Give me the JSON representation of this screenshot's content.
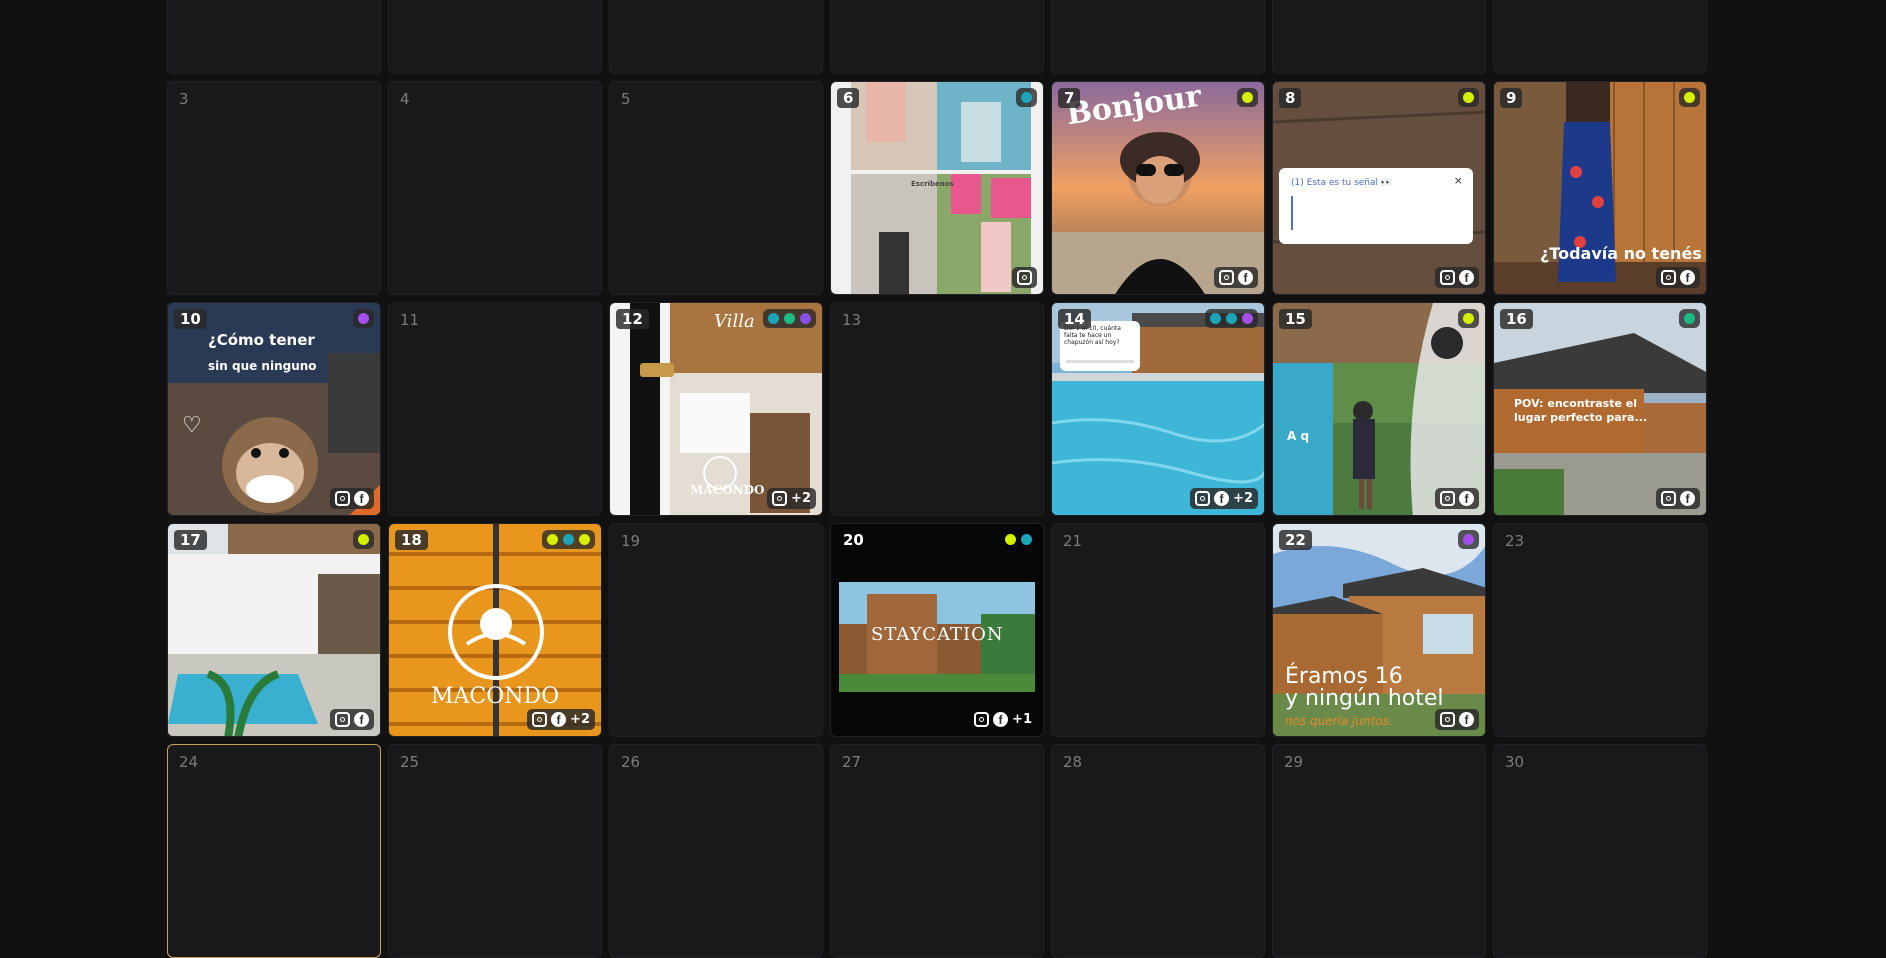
{
  "calendar": {
    "row0": [
      {},
      {},
      {},
      {},
      {},
      {},
      {}
    ],
    "rows": [
      [
        {
          "day": "3"
        },
        {
          "day": "4"
        },
        {
          "day": "5"
        },
        {
          "day": "6",
          "post": true,
          "dots": [
            "#1aa6b7"
          ],
          "platforms": [
            "instagram"
          ],
          "extra": "",
          "story_text": "Escríbenos"
        },
        {
          "day": "7",
          "post": true,
          "dots": [
            "#d4f000"
          ],
          "platforms": [
            "instagram",
            "facebook"
          ],
          "extra": "",
          "overlay": "Bonjour"
        },
        {
          "day": "8",
          "post": true,
          "dots": [
            "#d4f000"
          ],
          "platforms": [
            "instagram",
            "facebook"
          ],
          "extra": "",
          "overlay": "(1) Esta es tu señal 👀"
        },
        {
          "day": "9",
          "post": true,
          "dots": [
            "#d4f000"
          ],
          "platforms": [
            "instagram",
            "facebook"
          ],
          "extra": "",
          "overlay": "¿Todavía no tenés"
        }
      ],
      [
        {
          "day": "10",
          "post": true,
          "dots": [
            "#a64fe8"
          ],
          "platforms": [
            "instagram",
            "facebook"
          ],
          "extra": "",
          "overlay": "¿Cómo tener",
          "overlay2": "sin que ninguno"
        },
        {
          "day": "11"
        },
        {
          "day": "12",
          "post": true,
          "dots": [
            "#1aa6b7",
            "#1abc84",
            "#8a4fe8"
          ],
          "platforms": [
            "instagram"
          ],
          "extra": "+2",
          "overlay": "MACONDO",
          "overlay2": "Villa"
        },
        {
          "day": "13"
        },
        {
          "day": "14",
          "post": true,
          "dots": [
            "#1aa6b7",
            "#1aa6b7",
            "#a64fe8"
          ],
          "platforms": [
            "instagram",
            "facebook"
          ],
          "extra": "+2",
          "overlay": "Del 1 al 10, cuánta falta te hace un chapuzón así hoy?"
        },
        {
          "day": "15",
          "post": true,
          "dots": [
            "#d4f000"
          ],
          "platforms": [
            "instagram",
            "facebook"
          ],
          "extra": "",
          "overlay": "A q"
        },
        {
          "day": "16",
          "post": true,
          "dots": [
            "#1abc84"
          ],
          "platforms": [
            "instagram",
            "facebook"
          ],
          "extra": "",
          "overlay": "POV: encontraste el lugar perfecto para..."
        }
      ],
      [
        {
          "day": "17",
          "post": true,
          "dots": [
            "#d4f000"
          ],
          "platforms": [
            "instagram",
            "facebook"
          ],
          "extra": ""
        },
        {
          "day": "18",
          "post": true,
          "dots": [
            "#d4f000",
            "#1aa6b7",
            "#d4f000"
          ],
          "platforms": [
            "instagram",
            "facebook"
          ],
          "extra": "+2",
          "overlay": "MACONDO"
        },
        {
          "day": "19"
        },
        {
          "day": "20",
          "post": true,
          "dots": [
            "#d4f000",
            "#1aa6b7"
          ],
          "platforms": [
            "instagram",
            "facebook"
          ],
          "extra": "+1",
          "overlay": "STAYCATION"
        },
        {
          "day": "21"
        },
        {
          "day": "22",
          "post": true,
          "dots": [
            "#a64fe8"
          ],
          "platforms": [
            "instagram",
            "facebook"
          ],
          "extra": "",
          "overlay": "Éramos 16",
          "overlay2": "y ningún hotel",
          "overlay3": "nos quería juntos."
        },
        {
          "day": "23"
        }
      ],
      [
        {
          "day": "24",
          "today": true
        },
        {
          "day": "25"
        },
        {
          "day": "26"
        },
        {
          "day": "27"
        },
        {
          "day": "28"
        },
        {
          "day": "29"
        },
        {
          "day": "30"
        }
      ]
    ]
  }
}
